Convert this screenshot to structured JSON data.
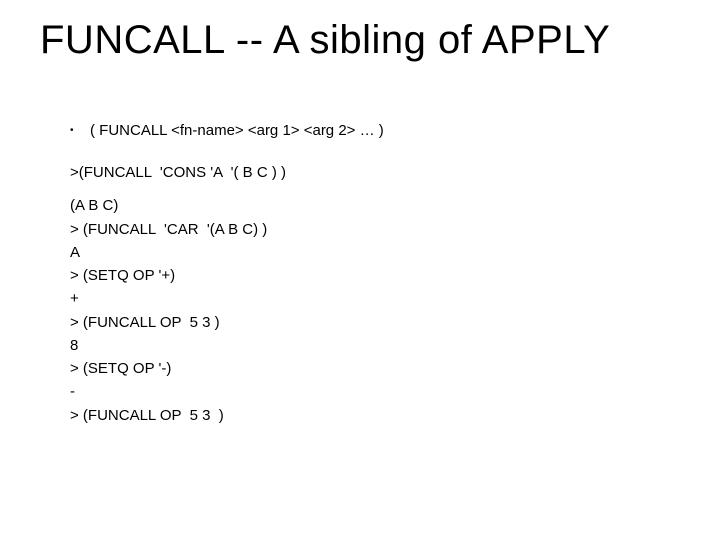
{
  "title": "FUNCALL -- A sibling of APPLY",
  "bullet": {
    "dot": "•",
    "text": "( FUNCALL <fn-name> <arg 1> <arg 2> … )"
  },
  "lines": [
    ">(FUNCALL  'CONS 'A  '( B C ) )",
    "",
    "(A B C)",
    "> (FUNCALL  'CAR  '(A B C) )",
    "A",
    "> (SETQ OP '+)",
    "+",
    "> (FUNCALL OP  5 3 )",
    "8",
    "> (SETQ OP '-)",
    "-",
    "> (FUNCALL OP  5 3  )"
  ]
}
